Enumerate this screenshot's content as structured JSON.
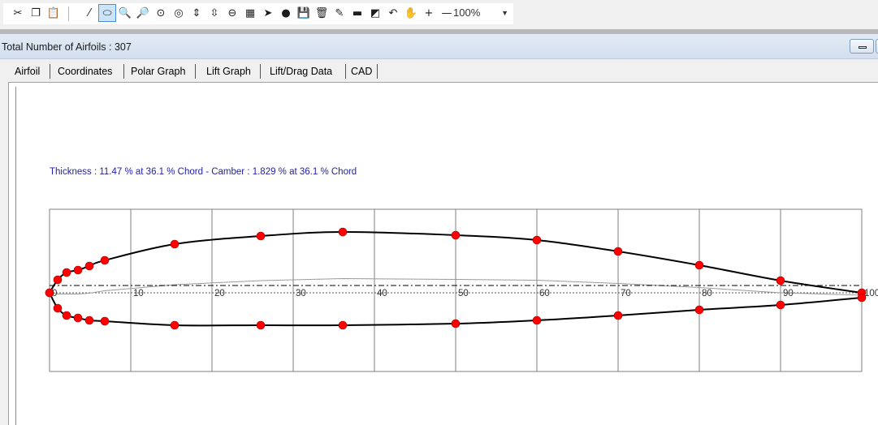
{
  "toolbar": {
    "buttons": [
      {
        "name": "cut-icon",
        "glyph": "✂"
      },
      {
        "name": "copy-icon",
        "glyph": "❐"
      },
      {
        "name": "paste-icon",
        "glyph": "📋"
      },
      {
        "name": "separator"
      },
      {
        "name": "airfoil-draw-icon",
        "glyph": "⁄"
      },
      {
        "name": "airfoil-shape-icon",
        "glyph": "⬭",
        "active": true
      },
      {
        "name": "zoom-in-icon",
        "glyph": "🔍"
      },
      {
        "name": "zoom-out-icon",
        "glyph": "🔎"
      },
      {
        "name": "target-icon",
        "glyph": "⊙"
      },
      {
        "name": "ring-icon",
        "glyph": "◎"
      },
      {
        "name": "thickness-icon",
        "glyph": "⇕"
      },
      {
        "name": "camber-icon",
        "glyph": "⇳"
      },
      {
        "name": "profile-icon",
        "glyph": "⊖"
      },
      {
        "name": "calculator-icon",
        "glyph": "▦"
      },
      {
        "name": "pointer-icon",
        "glyph": "➤"
      },
      {
        "name": "add-point-icon",
        "glyph": "●"
      },
      {
        "name": "save-icon",
        "glyph": "💾"
      },
      {
        "name": "delete-icon",
        "glyph": "🗑"
      },
      {
        "name": "tool-icon",
        "glyph": "✎"
      },
      {
        "name": "fill-icon",
        "glyph": "▬"
      },
      {
        "name": "paint-icon",
        "glyph": "◩"
      },
      {
        "name": "undo-icon",
        "glyph": "↶"
      },
      {
        "name": "hand-icon",
        "glyph": "✋"
      },
      {
        "name": "plus-icon",
        "glyph": "+"
      },
      {
        "name": "minus-icon",
        "glyph": "—"
      }
    ],
    "zoom_value": "100%"
  },
  "header": {
    "title": "Total Number of Airfoils : 307"
  },
  "tabs": [
    "Airfoil",
    "Coordinates",
    "Polar Graph",
    "Lift Graph",
    "Lift/Drag Data",
    "CAD"
  ],
  "stats_text": "Thickness : 11.47 % at 36.1 % Chord - Camber : 1.829 % at 36.1 % Chord",
  "colors": {
    "point": "#ff0000",
    "outline": "#000000",
    "camber": "#9a9a9a",
    "grid": "#808080",
    "stats_text": "#1f1fa8"
  },
  "chart_data": {
    "type": "scatter",
    "x_ticks": [
      0,
      10,
      20,
      30,
      40,
      50,
      60,
      70,
      80,
      90,
      100
    ],
    "x_tick_labels": [
      "0",
      "10",
      "20",
      "30",
      "40",
      "50",
      "60",
      "70",
      "80",
      "90",
      "100"
    ],
    "xlim": [
      0,
      100
    ],
    "ylim": [
      -9.7,
      10.3
    ],
    "grid": true,
    "series": [
      {
        "values": [
          [
            100,
            0.0
          ],
          [
            90,
            1.5
          ],
          [
            80,
            3.4
          ],
          [
            70,
            5.1
          ],
          [
            60,
            6.5
          ],
          [
            50,
            7.1
          ],
          [
            36.1,
            7.5
          ],
          [
            26,
            7.0
          ],
          [
            15.4,
            6.0
          ],
          [
            6.8,
            4.0
          ],
          [
            4.9,
            3.3
          ],
          [
            3.5,
            2.8
          ],
          [
            2.1,
            2.5
          ],
          [
            1.0,
            1.6
          ],
          [
            0,
            0.0
          ]
        ]
      },
      {
        "values": [
          [
            0,
            0.0
          ],
          [
            1.0,
            -1.9
          ],
          [
            2.1,
            -2.8
          ],
          [
            3.5,
            -3.1
          ],
          [
            4.9,
            -3.4
          ],
          [
            6.8,
            -3.5
          ],
          [
            15.4,
            -4.0
          ],
          [
            26,
            -4.0
          ],
          [
            36.1,
            -4.0
          ],
          [
            50,
            -3.8
          ],
          [
            60,
            -3.4
          ],
          [
            70,
            -2.8
          ],
          [
            80,
            -2.1
          ],
          [
            90,
            -1.5
          ],
          [
            100,
            -0.6
          ]
        ]
      }
    ]
  }
}
